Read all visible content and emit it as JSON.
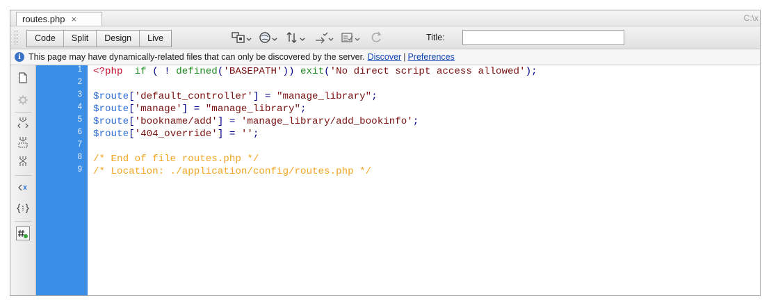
{
  "tab": {
    "filename": "routes.php",
    "close_glyph": "×",
    "path_label": "C:\\x"
  },
  "toolbar": {
    "view_buttons": [
      "Code",
      "Split",
      "Design",
      "Live"
    ],
    "title_label": "Title:",
    "title_value": "",
    "icons": [
      "multiscreen-icon",
      "preview-browser-icon",
      "file-management-icon",
      "check-page-icon",
      "visual-aids-icon",
      "refresh-icon"
    ]
  },
  "infobar": {
    "message": "This page may have dynamically-related files that can only be discovered by the server.",
    "discover_link": "Discover",
    "separator": "|",
    "preferences_link": "Preferences"
  },
  "editor": {
    "line_numbers": [
      "1",
      "2",
      "3",
      "4",
      "5",
      "6",
      "7",
      "8",
      "9"
    ],
    "lines": [
      [
        {
          "t": "<?php",
          "c": "tag"
        },
        {
          "t": "  ",
          "c": "op"
        },
        {
          "t": "if",
          "c": "kw"
        },
        {
          "t": " ( ! ",
          "c": "op"
        },
        {
          "t": "defined",
          "c": "kw"
        },
        {
          "t": "(",
          "c": "op"
        },
        {
          "t": "'BASEPATH'",
          "c": "str"
        },
        {
          "t": ")) ",
          "c": "op"
        },
        {
          "t": "exit",
          "c": "kw"
        },
        {
          "t": "(",
          "c": "op"
        },
        {
          "t": "'No direct script access allowed'",
          "c": "str"
        },
        {
          "t": ");",
          "c": "op"
        }
      ],
      [],
      [
        {
          "t": "$route",
          "c": "var"
        },
        {
          "t": "[",
          "c": "op"
        },
        {
          "t": "'default_controller'",
          "c": "str"
        },
        {
          "t": "] = ",
          "c": "op"
        },
        {
          "t": "\"manage_library\"",
          "c": "str"
        },
        {
          "t": ";",
          "c": "op"
        }
      ],
      [
        {
          "t": "$route",
          "c": "var"
        },
        {
          "t": "[",
          "c": "op"
        },
        {
          "t": "'manage'",
          "c": "str"
        },
        {
          "t": "] = ",
          "c": "op"
        },
        {
          "t": "\"manage_library\"",
          "c": "str"
        },
        {
          "t": ";",
          "c": "op"
        }
      ],
      [
        {
          "t": "$route",
          "c": "var"
        },
        {
          "t": "[",
          "c": "op"
        },
        {
          "t": "'bookname/add'",
          "c": "str"
        },
        {
          "t": "] = ",
          "c": "op"
        },
        {
          "t": "'manage_library/add_bookinfo'",
          "c": "str"
        },
        {
          "t": ";",
          "c": "op"
        }
      ],
      [
        {
          "t": "$route",
          "c": "var"
        },
        {
          "t": "[",
          "c": "op"
        },
        {
          "t": "'404_override'",
          "c": "str"
        },
        {
          "t": "] = ",
          "c": "op"
        },
        {
          "t": "''",
          "c": "str"
        },
        {
          "t": ";",
          "c": "op"
        }
      ],
      [],
      [
        {
          "t": "/* End of file routes.php */",
          "c": "cmt"
        }
      ],
      [
        {
          "t": "/* Location: ./application/config/routes.php */",
          "c": "cmt"
        }
      ]
    ],
    "side_icons": [
      "file-icon",
      "gear-icon",
      "collapse-tag-icon",
      "collapse-selection-icon",
      "expand-all-icon",
      "indent-code-icon",
      "code-braces-icon",
      "format-source-icon"
    ]
  },
  "colors": {
    "gutter": "#3a8ee6",
    "tag": "#c8102e",
    "keyword": "#1f8a1f",
    "string": "#7a1010",
    "variable": "#2f6ed8",
    "comment": "#f2a520"
  }
}
